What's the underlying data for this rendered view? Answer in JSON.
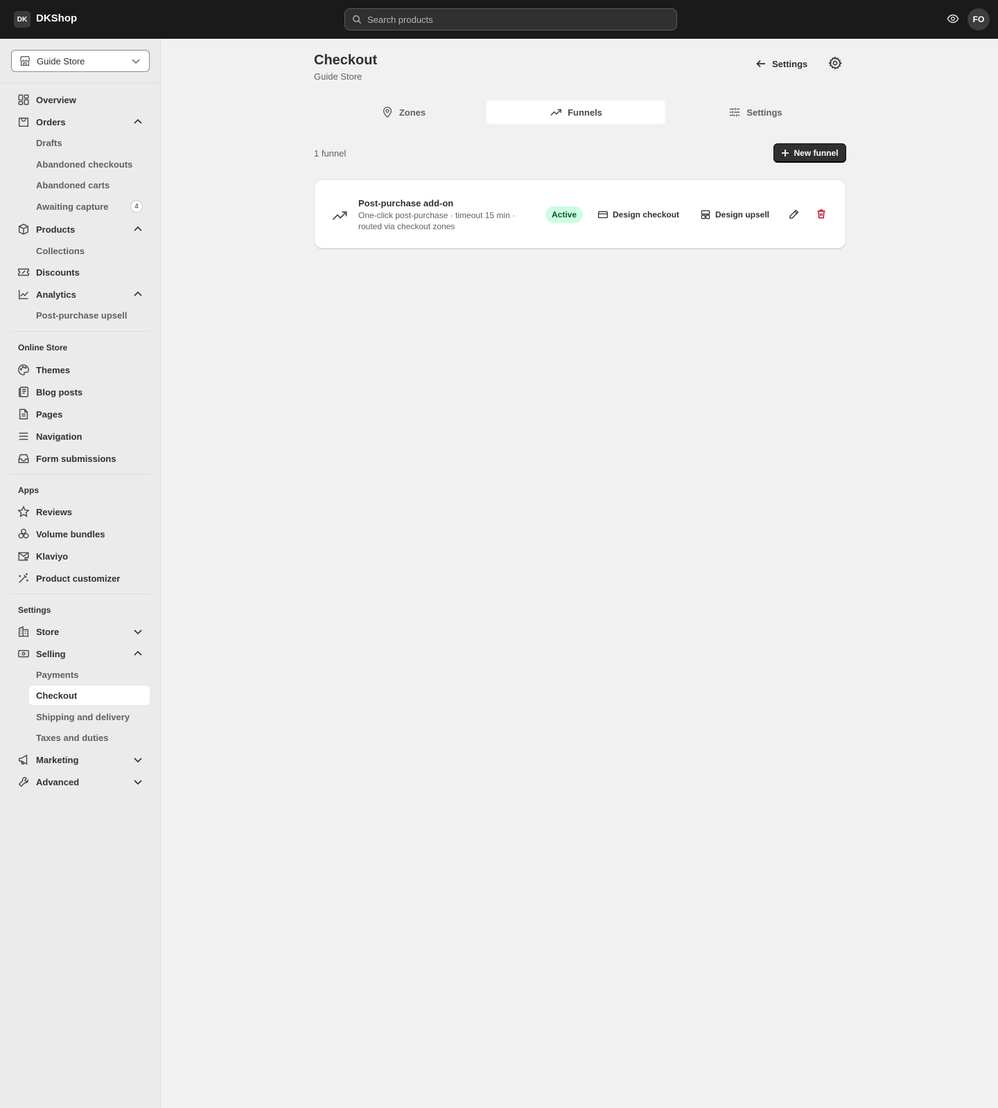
{
  "topbar": {
    "logo": "DK",
    "brand": "DKShop",
    "search_placeholder": "Search products",
    "avatar": "FO"
  },
  "sidebar": {
    "store": "Guide Store",
    "main": [
      {
        "label": "Overview",
        "icon": "overview-icon"
      },
      {
        "label": "Orders",
        "icon": "orders-icon",
        "expanded": true
      },
      {
        "label": "Drafts"
      },
      {
        "label": "Abandoned checkouts"
      },
      {
        "label": "Abandoned carts"
      },
      {
        "label": "Awaiting capture",
        "badge": "4"
      },
      {
        "label": "Products",
        "icon": "products-icon",
        "expanded": true
      },
      {
        "label": "Collections"
      },
      {
        "label": "Discounts",
        "icon": "discounts-icon"
      },
      {
        "label": "Analytics",
        "icon": "analytics-icon",
        "expanded": true
      },
      {
        "label": "Post-purchase upsell"
      }
    ],
    "online_store_title": "Online Store",
    "online_store": [
      "Themes",
      "Blog posts",
      "Pages",
      "Navigation",
      "Form submissions"
    ],
    "apps_title": "Apps",
    "apps": [
      "Reviews",
      "Volume bundles",
      "Klaviyo",
      "Product customizer"
    ],
    "settings_title": "Settings",
    "settings": [
      "Store",
      "Selling",
      "Payments",
      "Checkout",
      "Shipping and delivery",
      "Taxes and duties",
      "Marketing",
      "Advanced"
    ]
  },
  "main": {
    "title": "Checkout",
    "subtitle": "Guide Store",
    "back_label": "Settings",
    "tabs": [
      {
        "label": "Zones",
        "active": false
      },
      {
        "label": "Funnels",
        "active": true
      },
      {
        "label": "Settings",
        "active": false
      }
    ],
    "count": "1 funnel",
    "new_button": "New funnel",
    "funnel": {
      "name": "Post-purchase add-on",
      "description": "One-click post-purchase · timeout 15 min · routed via checkout zones",
      "status": "Active",
      "design_checkout": "Design checkout",
      "design_upsell": "Design upsell"
    }
  },
  "colors": {
    "topbar": "#1a1a1a",
    "sidebar": "#ebebeb",
    "background": "#f1f1f1",
    "active_badge_bg": "#cdfee1",
    "active_badge_text": "#0c5132",
    "delete": "#c70a24"
  }
}
